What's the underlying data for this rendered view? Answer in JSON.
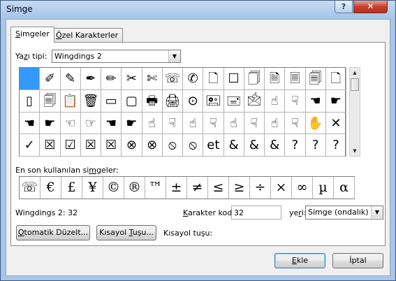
{
  "window": {
    "title": "Simge",
    "help_label": "?",
    "close_label": "✕"
  },
  "tabs": [
    {
      "label": "Simgeler",
      "mnemonic": "S",
      "active": true
    },
    {
      "label": "Özel Karakterler",
      "mnemonic": "Ö",
      "active": false
    }
  ],
  "font": {
    "label": "Yazı tipi:",
    "value": "Wingdings 2"
  },
  "symbol_grid": {
    "rows": [
      [
        "",
        "✐",
        "✎",
        "✒",
        "✏",
        "✂",
        "✄",
        "☏",
        "✆",
        "🗋",
        "☐",
        "🗍",
        "🗎",
        "🗏",
        "🗐",
        "🗋"
      ],
      [
        "▯",
        "🗐",
        "📋",
        "🗑",
        "▭",
        "▢",
        "🖶",
        "🖨",
        "⊙",
        "🖭",
        "🖃",
        "🖄",
        "☝",
        "☟",
        "☚",
        "☛"
      ],
      [
        "☚",
        "☛",
        "☜",
        "☞",
        "☚",
        "☛",
        "☝",
        "☟",
        "☝",
        "☟",
        "☝",
        "☟",
        "☝",
        "☟",
        "✋",
        "✕"
      ],
      [
        "✓",
        "☒",
        "☑",
        "☒",
        "☒",
        "⊗",
        "⊗",
        "⦸",
        "⦸",
        "et",
        "&",
        "&",
        "&",
        "?",
        "?",
        "?"
      ]
    ],
    "selected_index": 0
  },
  "recent": {
    "label": "En son kullanılan simgeler:",
    "mnemonic": "m",
    "symbols": [
      "☏",
      "€",
      "£",
      "¥",
      "©",
      "®",
      "™",
      "±",
      "≠",
      "≤",
      "≥",
      "÷",
      "×",
      "∞",
      "µ",
      "α"
    ]
  },
  "status": {
    "char_name": "Wingdings 2: 32"
  },
  "char_code": {
    "label": "Karakter kodu:",
    "value": "32"
  },
  "from": {
    "label": "yeri:",
    "value": "Simge (ondalık)"
  },
  "buttons": {
    "autocorrect": "Otomatik Düzelt...",
    "shortcut": "Kısayol Tuşu...",
    "shortcut_key_label": "Kısayol tuşu:",
    "insert": "Ekle",
    "cancel": "İptal"
  },
  "colors": {
    "selection": "#3399ff",
    "close_red": "#c7412e",
    "titlebar": "#a8c5e8"
  }
}
